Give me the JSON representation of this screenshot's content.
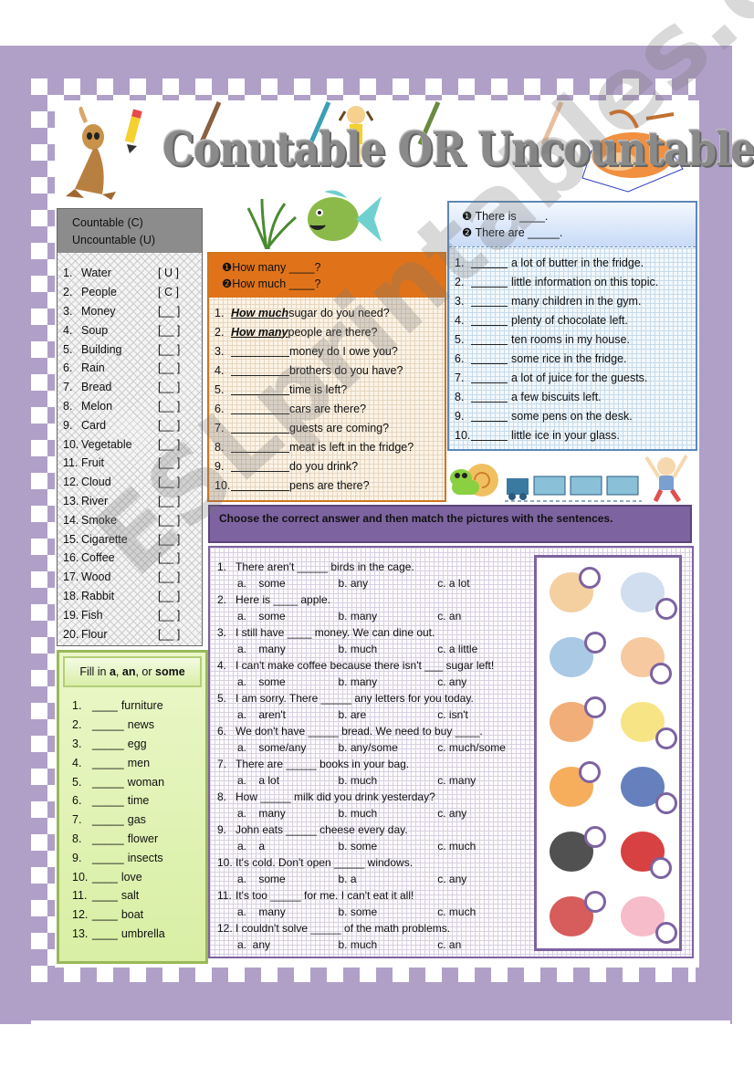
{
  "title": "Conutable OR Uncountable?",
  "watermark": "ESLprintables.com",
  "colors": {
    "frame": "#b0a0c8",
    "header_gray": "#8c8c8c",
    "orange_accent": "#e0731a",
    "blue_accent": "#5c88b8",
    "purple_accent": "#7d63a0",
    "green_accent": "#9ab85a"
  },
  "countable_box": {
    "header_line1": "Countable (C)",
    "header_line2": "Uncountable (U)",
    "items": [
      {
        "num": "1.",
        "word": "Water",
        "answer": "[ U ]"
      },
      {
        "num": "2.",
        "word": "People",
        "answer": "[ C ]"
      },
      {
        "num": "3.",
        "word": "Money",
        "answer": "[__ ]"
      },
      {
        "num": "4.",
        "word": "Soup",
        "answer": "[__ ]"
      },
      {
        "num": "5.",
        "word": "Building",
        "answer": "[__ ]"
      },
      {
        "num": "6.",
        "word": "Rain",
        "answer": "[__ ]"
      },
      {
        "num": "7.",
        "word": "Bread",
        "answer": "[__ ]"
      },
      {
        "num": "8.",
        "word": "Melon",
        "answer": "[__ ]"
      },
      {
        "num": "9.",
        "word": "Card",
        "answer": "[__ ]"
      },
      {
        "num": "10.",
        "word": "Vegetable",
        "answer": "[__ ]"
      },
      {
        "num": "11.",
        "word": "Fruit",
        "answer": "[__ ]"
      },
      {
        "num": "12.",
        "word": "Cloud",
        "answer": "[__ ]"
      },
      {
        "num": "13.",
        "word": "River",
        "answer": "[__ ]"
      },
      {
        "num": "14.",
        "word": "Smoke",
        "answer": "[__ ]"
      },
      {
        "num": "15.",
        "word": "Cigarette",
        "answer": "[__ ]"
      },
      {
        "num": "16.",
        "word": "Coffee",
        "answer": "[__ ]"
      },
      {
        "num": "17.",
        "word": "Wood",
        "answer": "[__ ]"
      },
      {
        "num": "18.",
        "word": "Rabbit",
        "answer": "[__ ]"
      },
      {
        "num": "19.",
        "word": "Fish",
        "answer": "[__ ]"
      },
      {
        "num": "20.",
        "word": "Flour",
        "answer": "[__ ]"
      }
    ]
  },
  "fill_box": {
    "header_prefix": "Fill in ",
    "header_a": "a",
    "header_sep1": ", ",
    "header_an": "an",
    "header_sep2": ", or ",
    "header_some": "some",
    "items": [
      {
        "num": "1.",
        "blank": "____",
        "word": "furniture"
      },
      {
        "num": "2.",
        "blank": "_____",
        "word": "news"
      },
      {
        "num": "3.",
        "blank": "_____",
        "word": "egg"
      },
      {
        "num": "4.",
        "blank": "_____",
        "word": "men"
      },
      {
        "num": "5.",
        "blank": "_____",
        "word": "woman"
      },
      {
        "num": "6.",
        "blank": "_____",
        "word": "time"
      },
      {
        "num": "7.",
        "blank": "_____",
        "word": "gas"
      },
      {
        "num": "8.",
        "blank": "_____",
        "word": "flower"
      },
      {
        "num": "9.",
        "blank": "_____",
        "word": "insects"
      },
      {
        "num": "10.",
        "blank": "____",
        "word": "love"
      },
      {
        "num": "11.",
        "blank": "____",
        "word": "salt"
      },
      {
        "num": "12.",
        "blank": "____",
        "word": "boat"
      },
      {
        "num": "13.",
        "blank": "____",
        "word": "umbrella"
      }
    ]
  },
  "how_box": {
    "option1": "❶How many ____?",
    "option2": "❷How much ____?",
    "items": [
      {
        "num": "1.",
        "answer": "How much",
        "rest": " sugar do you need?"
      },
      {
        "num": "2.",
        "answer": "How many",
        "rest": "people are there?"
      },
      {
        "num": "3.",
        "answer": "",
        "rest": "money do I owe you?"
      },
      {
        "num": "4.",
        "answer": "",
        "rest": "brothers do you have?"
      },
      {
        "num": "5.",
        "answer": "",
        "rest": " time is left?"
      },
      {
        "num": "6.",
        "answer": "",
        "rest": "cars are there?"
      },
      {
        "num": "7.",
        "answer": "",
        "rest": "guests are coming?"
      },
      {
        "num": "8.",
        "answer": "",
        "rest": "meat is left in the fridge?"
      },
      {
        "num": "9.",
        "answer": "",
        "rest": " do you drink?"
      },
      {
        "num": "10.",
        "answer": "",
        "rest": " pens are there?"
      }
    ]
  },
  "there_box": {
    "option1": "❶ There is ____.",
    "option2": "❷ There are _____.",
    "items": [
      {
        "num": "1.",
        "rest": "a lot of butter in the fridge."
      },
      {
        "num": "2.",
        "rest": "little information on this topic."
      },
      {
        "num": "3.",
        "rest": "many children in the gym."
      },
      {
        "num": "4.",
        "rest": "plenty of chocolate left."
      },
      {
        "num": "5.",
        "rest": "ten rooms in my house."
      },
      {
        "num": "6.",
        "rest": "some rice in the fridge."
      },
      {
        "num": "7.",
        "rest": "a lot of juice for the guests."
      },
      {
        "num": "8.",
        "rest": "a few biscuits left."
      },
      {
        "num": "9.",
        "rest": "some pens on the desk."
      },
      {
        "num": "10.",
        "rest": "little ice in your glass."
      }
    ]
  },
  "choose_section": {
    "instruction": "Choose the correct answer and then match the pictures with the sentences.",
    "questions": [
      {
        "num": "1.",
        "text": "There aren't _____ birds in the cage.",
        "a": "a.    some",
        "b": "b. any",
        "c": "c. a lot"
      },
      {
        "num": "2.",
        "text": "Here is ____ apple.",
        "a": "a.    some",
        "b": "b. many",
        "c": "c. an"
      },
      {
        "num": "3.",
        "text": "I still have ____ money. We can dine out.",
        "a": "a.    many",
        "b": "b. much",
        "c": "c. a little"
      },
      {
        "num": "4.",
        "text": "I can't make coffee because there isn't ___ sugar left!",
        "a": "a.    some",
        "b": "b. many",
        "c": "c. any"
      },
      {
        "num": "5.",
        "text": "I am sorry. There _____ any letters for you today.",
        "a": "a.    aren't",
        "b": "b. are",
        "c": "c. isn't"
      },
      {
        "num": "6.",
        "text": "We don't have _____ bread. We need to buy ____.",
        "a": "a.    some/any",
        "b": "b. any/some",
        "c": "c. much/some"
      },
      {
        "num": "7.",
        "text": "There are _____ books in your bag.",
        "a": "a.    a lot",
        "b": "b. much",
        "c": "c. many"
      },
      {
        "num": "8.",
        "text": "How _____ milk did you drink yesterday?",
        "a": "a.    many",
        "b": "b. much",
        "c": "c. any"
      },
      {
        "num": "9.",
        "text": "John eats _____ cheese every day.",
        "a": "a.    a",
        "b": "b. some",
        "c": "c. much"
      },
      {
        "num": "10.",
        "text": " It's cold. Don't open _____ windows.",
        "a": "a.    some",
        "b": "b. a",
        "c": "c. any"
      },
      {
        "num": "11.",
        "text": " It's too _____ for me. I can't eat it all!",
        "a": "a.    many",
        "b": "b. some",
        "c": "c. much"
      },
      {
        "num": "12.",
        "text": " I couldn't solve _____ of the math problems.",
        "a": "a.  any",
        "b": "b. much",
        "c": "c. an"
      }
    ],
    "pictures": [
      "man-eating-picture",
      "birdcage-picture",
      "window-picture",
      "man-with-money-picture",
      "boy-with-milk-picture",
      "cheese-picture",
      "bread-picture",
      "man-with-letters-picture",
      "coffee-cup-picture",
      "apple-picture",
      "school-bag-picture",
      "couple-dining-picture"
    ]
  }
}
